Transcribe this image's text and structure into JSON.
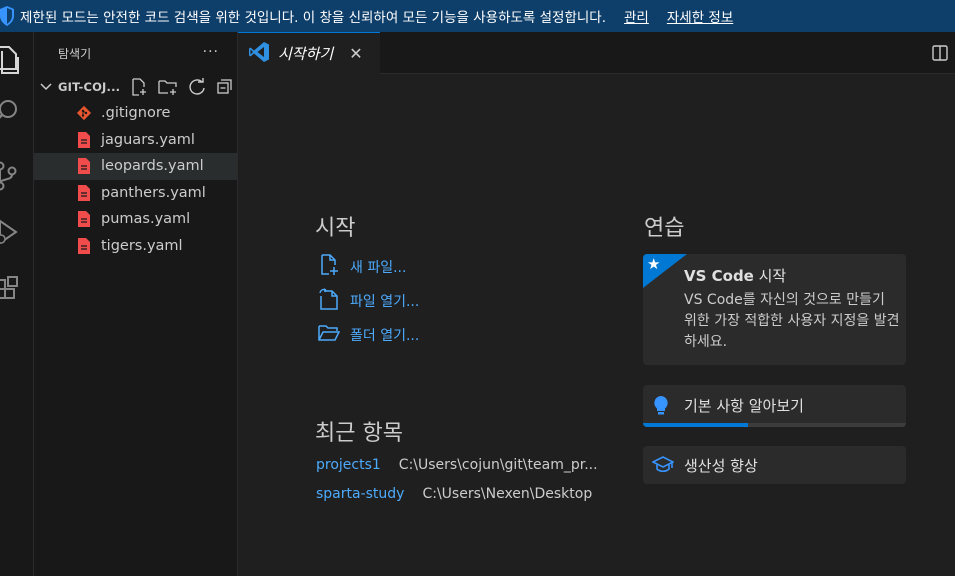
{
  "banner": {
    "message": "제한된 모드는 안전한 코드 검색을 위한 것입니다. 이 창을 신뢰하여 모든 기능을 사용하도록 설정합니다.",
    "manage_link": "관리",
    "details_link": "자세한 정보",
    "icon": "shield-icon",
    "background_color": "#0e3e6a"
  },
  "activity_bar": {
    "items": [
      "explorer-icon",
      "search-icon",
      "source-control-icon",
      "run-debug-icon",
      "extensions-icon"
    ]
  },
  "sidebar": {
    "title": "탐색기",
    "more_label": "···",
    "folder": {
      "name": "GIT-COJ...",
      "actions": [
        "new-file-icon",
        "new-folder-icon",
        "refresh-icon",
        "collapse-all-icon"
      ]
    },
    "files": [
      {
        "name": ".gitignore",
        "icon": "git-file-icon",
        "selected": false
      },
      {
        "name": "jaguars.yaml",
        "icon": "yaml-file-icon",
        "selected": false
      },
      {
        "name": "leopards.yaml",
        "icon": "yaml-file-icon",
        "selected": true
      },
      {
        "name": "panthers.yaml",
        "icon": "yaml-file-icon",
        "selected": false
      },
      {
        "name": "pumas.yaml",
        "icon": "yaml-file-icon",
        "selected": false
      },
      {
        "name": "tigers.yaml",
        "icon": "yaml-file-icon",
        "selected": false
      }
    ]
  },
  "tabs": [
    {
      "label": "시작하기",
      "icon": "vscode-logo-icon",
      "close": "✕",
      "active": true
    }
  ],
  "welcome": {
    "start": {
      "title": "시작",
      "items": [
        {
          "label": "새 파일...",
          "icon": "new-file-icon"
        },
        {
          "label": "파일 열기...",
          "icon": "open-file-icon"
        },
        {
          "label": "폴더 열기...",
          "icon": "open-folder-icon"
        }
      ]
    },
    "recent": {
      "title": "최근 항목",
      "items": [
        {
          "name": "projects1",
          "path": "C:\\Users\\cojun\\git\\team_pr..."
        },
        {
          "name": "sparta-study",
          "path": "C:\\Users\\Nexen\\Desktop"
        }
      ]
    },
    "walkthroughs": {
      "title": "연습",
      "featured": {
        "title_bold": "VS Code",
        "title_rest": " 시작",
        "description": "VS Code를 자신의 것으로 만들기 위한 가장 적합한 사용자 지정을 발견하세요.",
        "icon": "star-icon"
      },
      "basics": {
        "label": "기본 사항 알아보기",
        "icon": "lightbulb-icon",
        "progress": 0.4
      },
      "productivity": {
        "label": "생산성 향상",
        "icon": "mortarboard-icon"
      }
    }
  },
  "colors": {
    "accent": "#0078d4",
    "link": "#4daafc",
    "yaml_icon": "#f14c4c",
    "git_icon": "#e8562f"
  }
}
